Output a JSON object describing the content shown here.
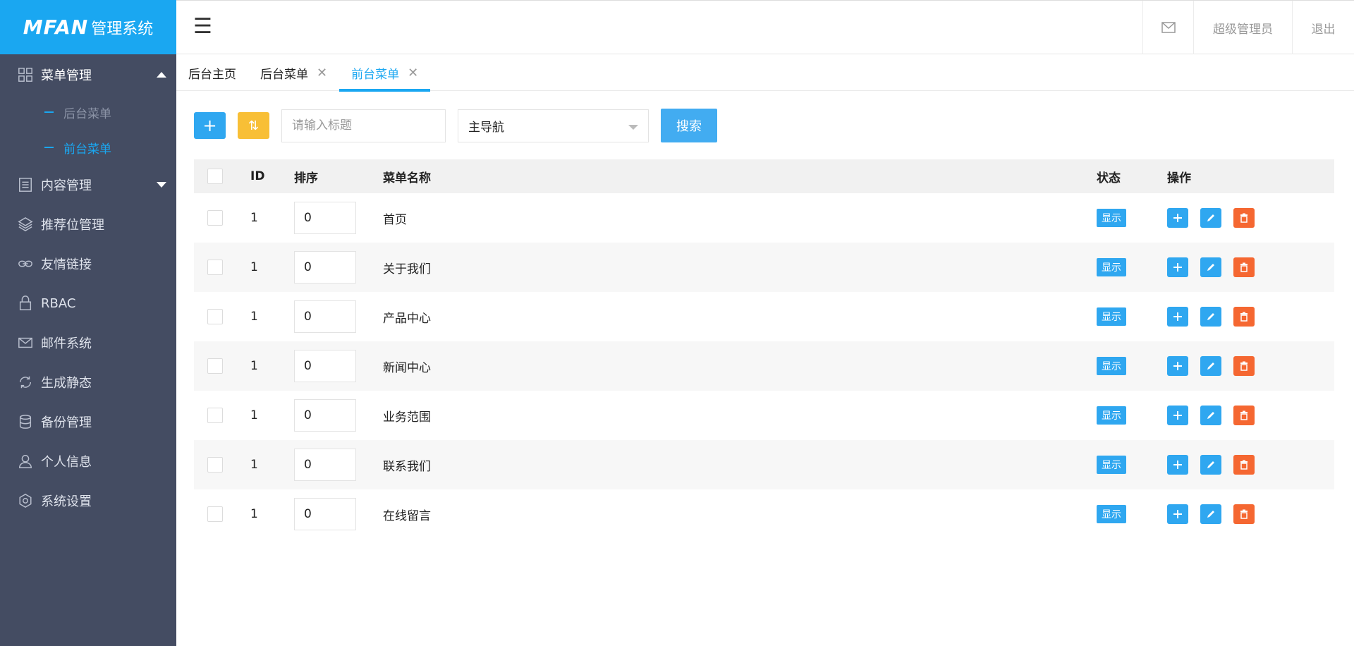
{
  "logo": {
    "brand": "MFAN",
    "subtitle": "管理系统"
  },
  "sidebar": {
    "items": [
      {
        "label": "菜单管理",
        "icon": "grid-icon",
        "expanded": true,
        "children": [
          {
            "label": "后台菜单",
            "active": false
          },
          {
            "label": "前台菜单",
            "active": true
          }
        ]
      },
      {
        "label": "内容管理",
        "icon": "document-icon",
        "expanded": false
      },
      {
        "label": "推荐位管理",
        "icon": "layers-icon"
      },
      {
        "label": "友情链接",
        "icon": "link-icon"
      },
      {
        "label": "RBAC",
        "icon": "lock-icon"
      },
      {
        "label": "邮件系统",
        "icon": "mail-icon"
      },
      {
        "label": "生成静态",
        "icon": "refresh-icon"
      },
      {
        "label": "备份管理",
        "icon": "database-icon"
      },
      {
        "label": "个人信息",
        "icon": "user-icon"
      },
      {
        "label": "系统设置",
        "icon": "gear-icon"
      }
    ]
  },
  "header": {
    "menu_icon": "☰",
    "admin": "超级管理员",
    "logout": "退出"
  },
  "tabs": [
    {
      "label": "后台主页",
      "closable": false,
      "active": false
    },
    {
      "label": "后台菜单",
      "closable": true,
      "active": false
    },
    {
      "label": "前台菜单",
      "closable": true,
      "active": true
    }
  ],
  "toolbar": {
    "add_label": "+",
    "sort_label": "⇅",
    "search_placeholder": "请输入标题",
    "nav_select": "主导航",
    "search_label": "搜索"
  },
  "table": {
    "headers": {
      "id": "ID",
      "sort": "排序",
      "name": "菜单名称",
      "status": "状态",
      "actions": "操作"
    },
    "rows": [
      {
        "id": "1",
        "sort": "0",
        "name": "首页",
        "status": "显示"
      },
      {
        "id": "1",
        "sort": "0",
        "name": "关于我们",
        "status": "显示"
      },
      {
        "id": "1",
        "sort": "0",
        "name": "产品中心",
        "status": "显示"
      },
      {
        "id": "1",
        "sort": "0",
        "name": "新闻中心",
        "status": "显示"
      },
      {
        "id": "1",
        "sort": "0",
        "name": "业务范围",
        "status": "显示"
      },
      {
        "id": "1",
        "sort": "0",
        "name": "联系我们",
        "status": "显示"
      },
      {
        "id": "1",
        "sort": "0",
        "name": "在线留言",
        "status": "显示"
      }
    ]
  },
  "colors": {
    "accent": "#1aa7f1",
    "sidebar_bg": "#444c62",
    "warning": "#f8bf36",
    "danger": "#f56731"
  }
}
